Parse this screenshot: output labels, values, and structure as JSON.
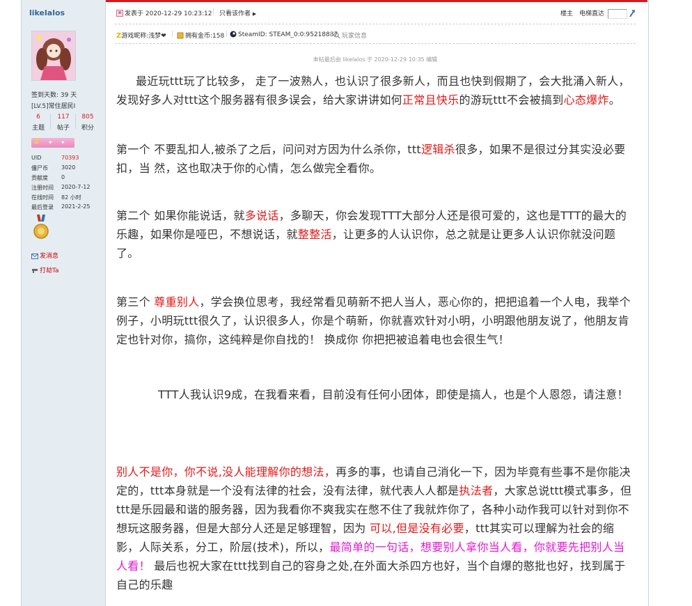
{
  "user": {
    "name": "likelalos",
    "checkin": "签到天数: 39 天",
    "level": "[LV.5]常住居民I",
    "stats": [
      {
        "num": "6",
        "label": "主题"
      },
      {
        "num": "117",
        "label": "帖子"
      },
      {
        "num": "805",
        "label": "积分"
      }
    ],
    "info": [
      {
        "k": "UID",
        "v": "70393",
        "red": true
      },
      {
        "k": "僵尸币",
        "v": "3020"
      },
      {
        "k": "贡献度",
        "v": "0"
      },
      {
        "k": "注册时间",
        "v": "2020-7-12"
      },
      {
        "k": "在线时间",
        "v": "82 小时"
      },
      {
        "k": "最后登录",
        "v": "2021-2-25"
      }
    ],
    "send_msg": "发消息",
    "tip": "打劫Ta"
  },
  "post_header": {
    "posted": "发表于 2020-12-29 10:23:12",
    "author_only": "只看该作者",
    "op": "楼主",
    "jump": "电梯直达",
    "game_name": "游戏昵称:浅梦❤",
    "coins": "拥有金币:158",
    "steam": "SteamID: STEAM_0:0:95218887",
    "player_info": "玩家信息",
    "edited": "本帖最后由 likelalos 于 2020-12-29 10:35 编辑"
  },
  "body": {
    "p1a": "最近玩ttt玩了比较多，  走了一波熟人，也认识了很多新人，而且也快到假期了，会大批涌入新人，发现好多人对ttt这个服务器有很多误会，给大家讲讲如何",
    "p1b": "正常且快乐",
    "p1c": "的游玩ttt不会被搞到",
    "p1d": "心态爆炸",
    "p1e": "。",
    "p2a": "第一个  不要乱扣人,被杀了之后，问问对方因为什么杀你，ttt",
    "p2b": "逻辑杀",
    "p2c": "很多，如果不是很过分其实没必要扣，当 然，这也取决于你的心情，怎么做完全看你。",
    "p3a": " 第二个  如果你能说话，就",
    "p3b": "多说话",
    "p3c": "，多聊天，你会发现TTT大部分人还是很可爱的，这也是TTT的最大的乐趣，如果你是哑巴，不想说话，就",
    "p3d": "整整活",
    "p3e": "，让更多的人认识你，总之就是让更多人认识你就没问题了。",
    "p4a": " 第三个 ",
    "p4b": " 尊重别人",
    "p4c": "，学会换位思考，我经常看见萌新不把人当人，恶心你的，把把追着一个人电，我举个例子，小明玩ttt很久了，认识很多人，你是个萌新，你就喜欢针对小明，小明跟他朋友说了，他朋友肯定也针对你，搞你，这纯粹是你自找的！ 换成你 你把把被追着电也会很生气！",
    "p5": "TTT人我认识9成，在我看来看，目前没有任何小团体，即使是搞人，也是个人恩怨，请注意！",
    "p6a": " 别人不是你，你不说,没人能理解你的想法，",
    "p6b": "再多的事，也请自己消化一下，因为毕竟有些事不是你能决定的，ttt本身就是一个没有法律的社会，没有法律，就代表人人都是",
    "p6c": "执法者",
    "p6d": "，大家总说ttt模式事多，但ttt是乐园最和谐的服务器，因为我看你不爽我实在憋不住了我就炸你了，各种小动作我可以针对到你不想玩这服务器，但是大部分人还是足够理智，因为 ",
    "p6e": "可以,但是没有必要",
    "p6f": "，ttt其实可以理解为社会的缩影，人际关系，分工，阶层(技术)，所以，",
    "p6g": "最简单的一句话，想要别人拿你当人看，你就要先把别人当人看！",
    "p6h": "      最后也祝大家在ttt找到自己的容身之处,在外面大杀四方也好，当个自爆的憨批也好，找到属于自己的乐趣"
  },
  "colors": {
    "accent_red": "#e21a1a",
    "magenta": "#e21ad2",
    "sidebar_bg": "#e5edf2",
    "border": "#c2d5e3"
  }
}
